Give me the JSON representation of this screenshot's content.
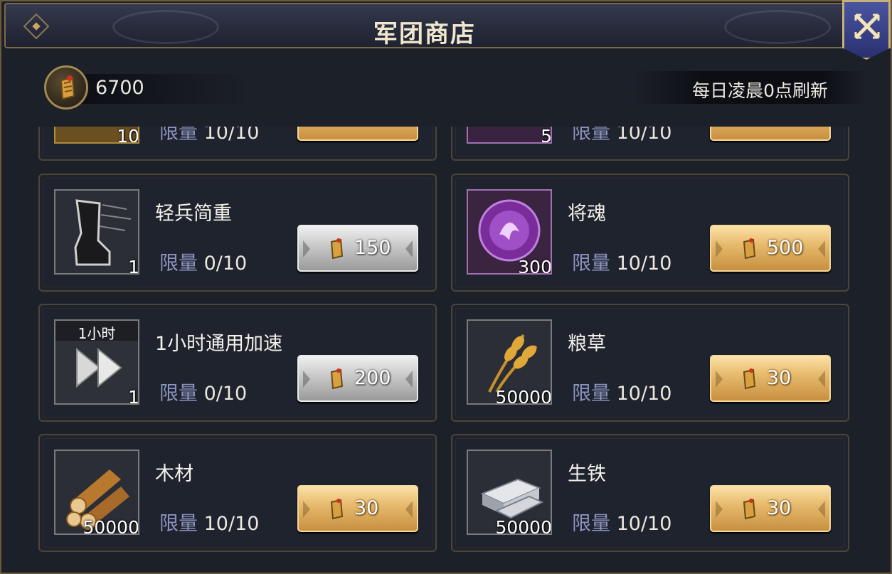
{
  "header": {
    "title": "军团商店"
  },
  "currency": {
    "amount": "6700",
    "icon": "scroll-token-icon"
  },
  "refresh_note": "每日凌晨0点刷新",
  "limit_label": "限量",
  "partial_row": [
    {
      "qty": "10",
      "limit": "10/10",
      "frame": "gold"
    },
    {
      "qty": "5",
      "limit": "10/10",
      "frame": "purple"
    }
  ],
  "items": [
    {
      "name": "轻兵简重",
      "qty": "1",
      "limit": "0/10",
      "price": "150",
      "button": "silver",
      "icon": "boot-icon",
      "frame": "gray"
    },
    {
      "name": "将魂",
      "qty": "300",
      "limit": "10/10",
      "price": "500",
      "button": "gold",
      "icon": "soul-orb-icon",
      "frame": "purple"
    },
    {
      "name": "1小时通用加速",
      "qty": "1",
      "limit": "0/10",
      "price": "200",
      "button": "silver",
      "icon": "speedup-icon",
      "frame": "gray",
      "badge": "1小时"
    },
    {
      "name": "粮草",
      "qty": "50000",
      "limit": "10/10",
      "price": "30",
      "button": "gold",
      "icon": "wheat-icon",
      "frame": "gray"
    },
    {
      "name": "木材",
      "qty": "50000",
      "limit": "10/10",
      "price": "30",
      "button": "gold",
      "icon": "wood-logs-icon",
      "frame": "gray"
    },
    {
      "name": "生铁",
      "qty": "50000",
      "limit": "10/10",
      "price": "30",
      "button": "gold",
      "icon": "iron-ingot-icon",
      "frame": "gray"
    }
  ]
}
